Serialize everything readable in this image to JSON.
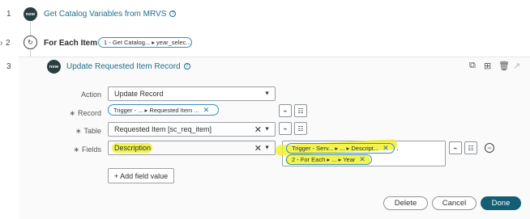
{
  "steps": [
    {
      "number": "1",
      "title": "Get Catalog Variables from MRVS",
      "logo_text": "now"
    },
    {
      "number": "2",
      "prefix": "For Each Item in",
      "pill": "1 - Get Catalog... ▸ year_selec..."
    },
    {
      "number": "3",
      "title": "Update Requested Item Record",
      "logo_text": "now"
    }
  ],
  "form": {
    "action_label": "Action",
    "action_value": "Update Record",
    "record_label": "Record",
    "record_pill": "Trigger - ... ▸ Requested Item ...",
    "table_label": "Table",
    "table_value": "Requested Item [sc_req_item]",
    "fields_label": "Fields",
    "field_name": "Description",
    "field_pill_1": "Trigger - Serv... ▸ ... ▸ Descript...",
    "field_pill_2": "2 - For Each ▸ ... ▸ Year",
    "field_dot": ".",
    "add_field_label": "+ Add field value"
  },
  "buttons": {
    "delete": "Delete",
    "cancel": "Cancel",
    "done": "Done"
  },
  "colors": {
    "accent": "#1f6f8b",
    "done": "#135e75",
    "highlight": "#f0f014",
    "logo": "#293e40"
  }
}
